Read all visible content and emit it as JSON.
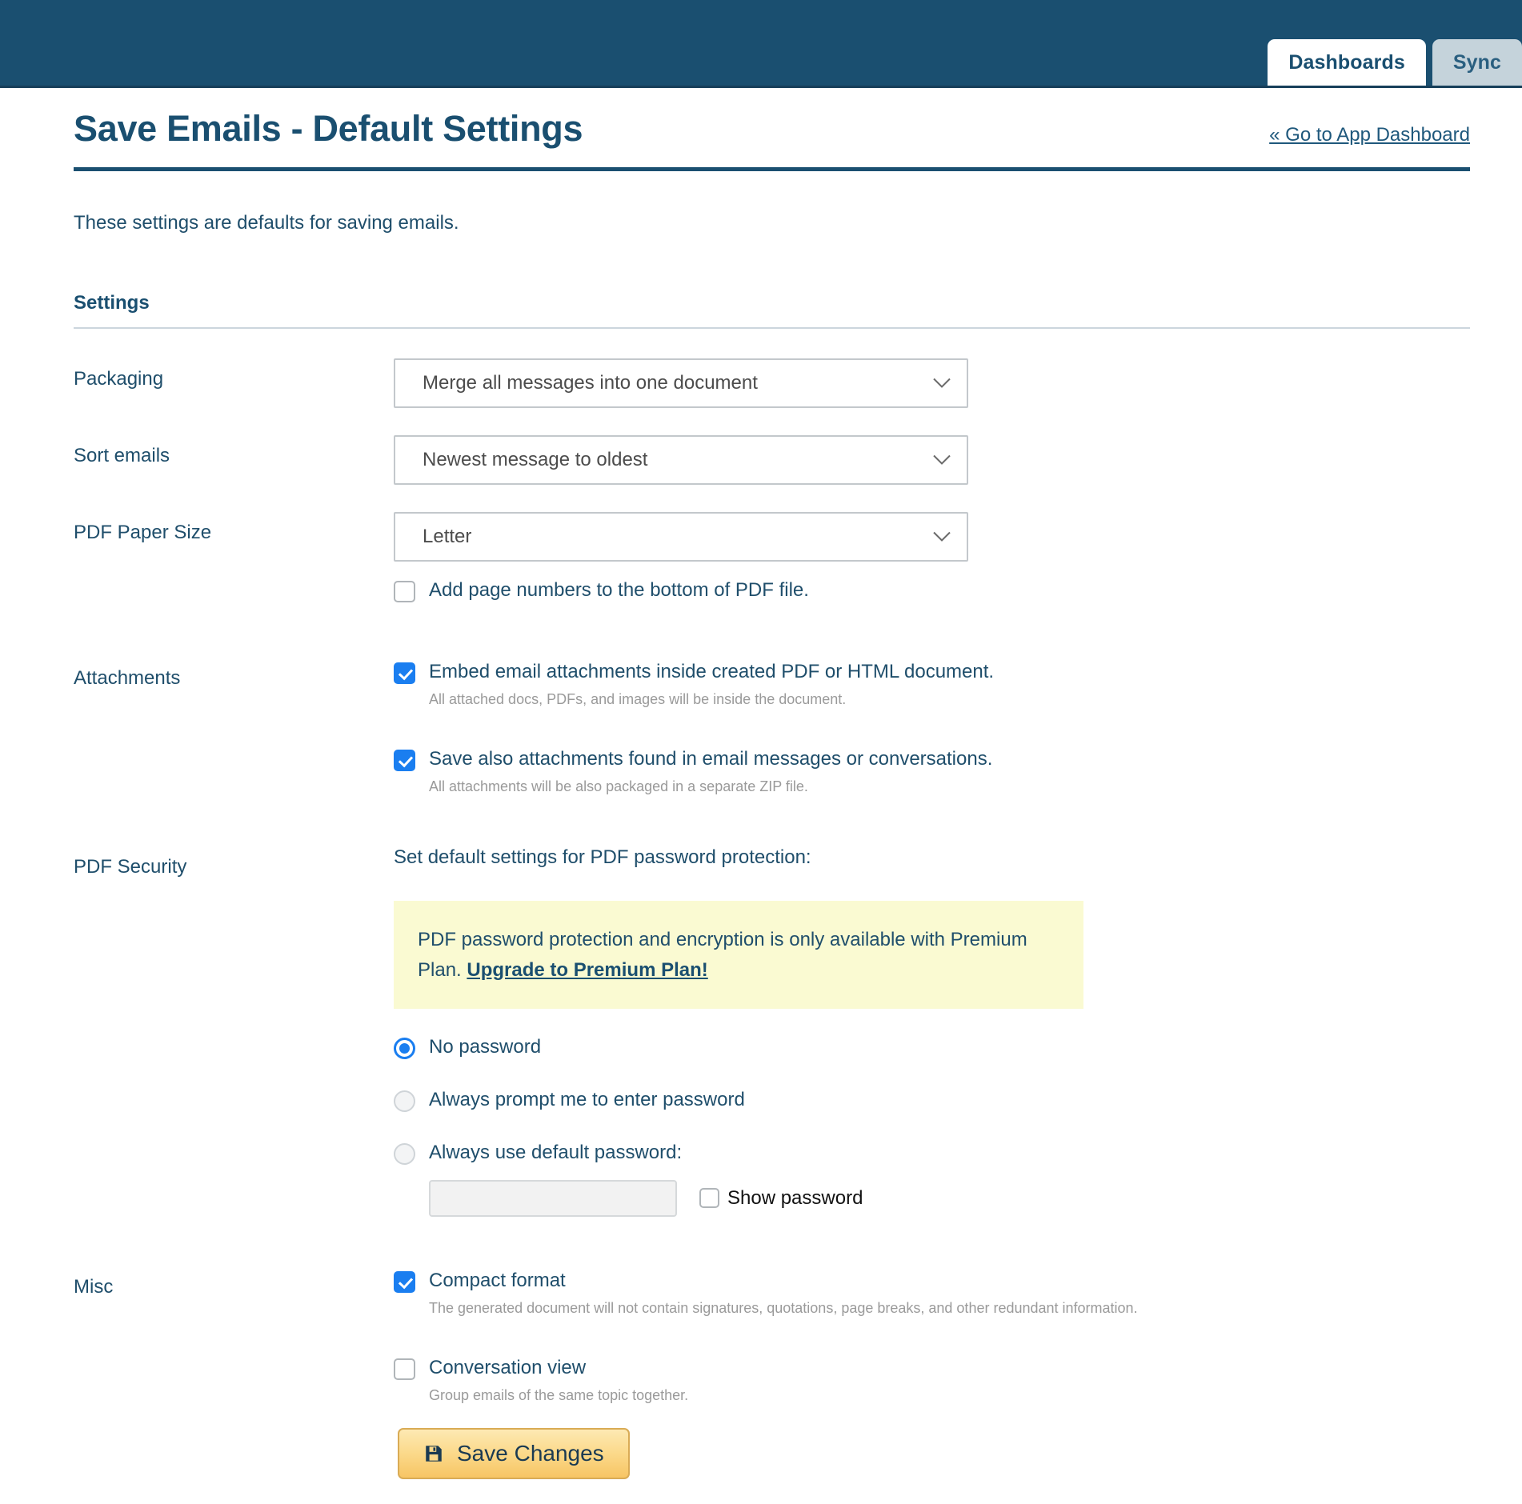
{
  "topbar": {
    "tabs": [
      {
        "label": "Dashboards",
        "active": true
      },
      {
        "label": "Sync",
        "active": false
      }
    ]
  },
  "header": {
    "title": "Save Emails - Default Settings",
    "dashboard_link": "« Go to App Dashboard"
  },
  "intro": "These settings are defaults for saving emails.",
  "section": {
    "title": "Settings"
  },
  "fields": {
    "packaging": {
      "label": "Packaging",
      "value": "Merge all messages into one document"
    },
    "sort_emails": {
      "label": "Sort emails",
      "value": "Newest message to oldest"
    },
    "pdf_paper_size": {
      "label": "PDF Paper Size",
      "value": "Letter"
    },
    "page_numbers": {
      "label": "Add page numbers to the bottom of PDF file.",
      "checked": false
    },
    "attachments": {
      "label": "Attachments",
      "embed": {
        "label": "Embed email attachments inside created PDF or HTML document.",
        "desc": "All attached docs, PDFs, and images will be inside the document.",
        "checked": true
      },
      "save_found": {
        "label": "Save also attachments found in email messages or conversations.",
        "desc": "All attachments will be also packaged in a separate ZIP file.",
        "checked": true
      }
    },
    "pdf_security": {
      "label": "PDF Security",
      "lead": "Set default settings for PDF password protection:",
      "notice_text": "PDF password protection and encryption is only available with Premium Plan. ",
      "notice_link": "Upgrade to Premium Plan!",
      "options": [
        {
          "label": "No password",
          "selected": true
        },
        {
          "label": "Always prompt me to enter password",
          "selected": false
        },
        {
          "label": "Always use default password:",
          "selected": false
        }
      ],
      "password_value": "",
      "password_placeholder": "",
      "show_password": {
        "label": "Show password",
        "checked": false
      }
    },
    "misc": {
      "label": "Misc",
      "compact": {
        "label": "Compact format",
        "desc": "The generated document will not contain signatures, quotations, page breaks, and other redundant information.",
        "checked": true
      },
      "conversation": {
        "label": "Conversation view",
        "desc": "Group emails of the same topic together.",
        "checked": false
      }
    }
  },
  "actions": {
    "save_label": "Save Changes",
    "save_icon": "floppy-disk-icon"
  },
  "colors": {
    "header_bar": "#1a4f70",
    "accent_blue": "#1a7ef0",
    "notice_bg": "#fafad2",
    "button_amber": "#f7c564"
  }
}
